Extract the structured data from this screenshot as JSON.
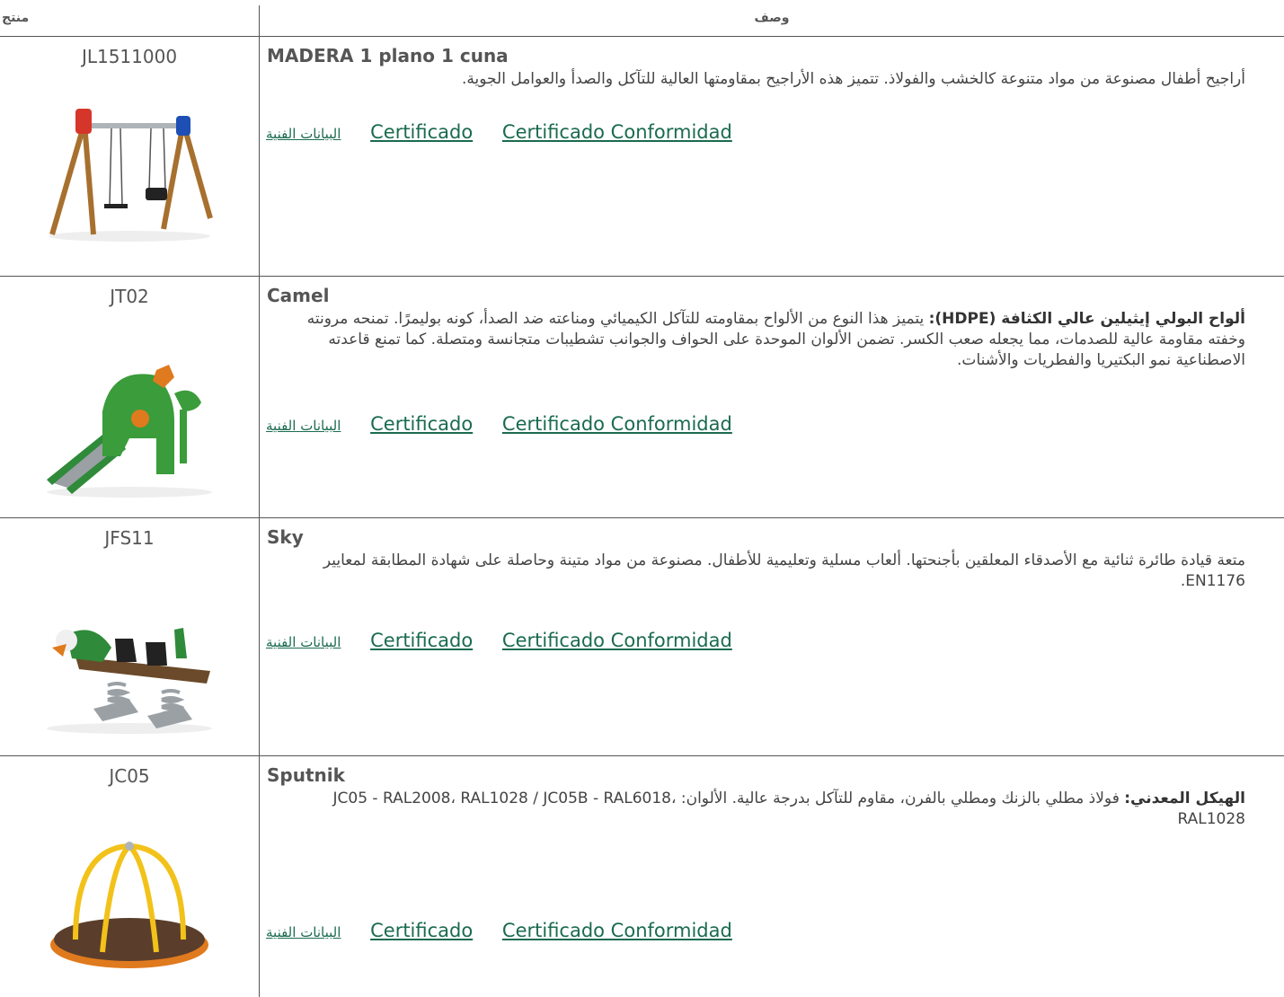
{
  "header": {
    "product": "منتج",
    "description": "وصف"
  },
  "links": {
    "tech": "البيانات الفنية",
    "cert": "Certificado",
    "conf": "Certificado Conformidad"
  },
  "products": [
    {
      "code": "JL1511000",
      "name": "MADERA 1 plano 1 cuna",
      "desc": "أراجيح أطفال مصنوعة من مواد متنوعة كالخشب والفولاذ. تتميز هذه الأراجيح بمقاومتها العالية للتآكل والصدأ والعوامل الجوية."
    },
    {
      "code": "JT02",
      "name": "Camel",
      "desc_bold": "ألواح البولي إيثيلين عالي الكثافة (HDPE):",
      "desc": " يتميز هذا النوع من الألواح بمقاومته للتآكل الكيميائي ومناعته ضد الصدأ، كونه بوليمرًا. تمنحه مرونته وخفته مقاومة عالية للصدمات، مما يجعله صعب الكسر. تضمن الألوان الموحدة على الحواف والجوانب تشطيبات متجانسة ومتصلة. كما تمنع قاعدته الاصطناعية نمو البكتيريا والفطريات والأشنات."
    },
    {
      "code": "JFS11",
      "name": "Sky",
      "desc": "متعة قيادة طائرة ثنائية مع الأصدقاء المعلقين بأجنحتها. ألعاب مسلية وتعليمية للأطفال. مصنوعة من مواد متينة وحاصلة على شهادة المطابقة لمعايير EN1176."
    },
    {
      "code": "JC05",
      "name": "Sputnik",
      "desc_bold": "الهيكل المعدني:",
      "desc": " فولاذ مطلي بالزنك ومطلي بالفرن، مقاوم للتآكل بدرجة عالية. الألوان: JC05 - RAL2008، RAL1028 / JC05B - RAL6018، RAL1028"
    }
  ],
  "colors": {
    "link": "#1a6b4e",
    "rule": "#555555",
    "text": "#444444"
  }
}
